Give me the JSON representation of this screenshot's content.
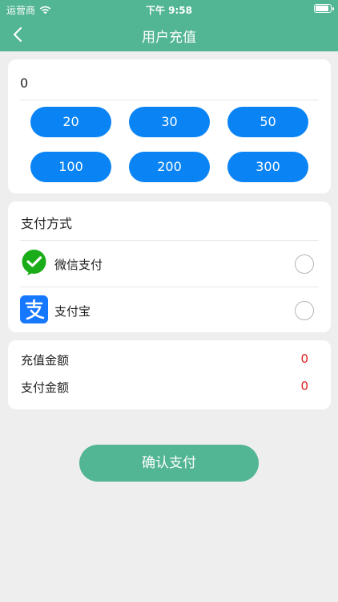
{
  "status_bar": {
    "carrier": "运营商",
    "time": "下午 9:58",
    "battery_level": 0.95
  },
  "nav": {
    "title": "用户充值",
    "back_icon": "chevron-left-icon"
  },
  "recharge": {
    "amount_value": "0",
    "options": [
      "20",
      "30",
      "50",
      "100",
      "200",
      "300"
    ]
  },
  "payment": {
    "section_title": "支付方式",
    "methods": [
      {
        "label": "微信支付",
        "icon": "wechat-pay-icon",
        "selected": false
      },
      {
        "label": "支付宝",
        "icon": "alipay-icon",
        "selected": false
      }
    ]
  },
  "summary": {
    "recharge_label": "充值金额",
    "recharge_value": "0",
    "pay_label": "支付金额",
    "pay_value": "0"
  },
  "confirm_label": "确认支付",
  "colors": {
    "header": "#52b594",
    "button_blue": "#0a84f5",
    "amount_red": "#e02020",
    "wechat_green": "#1aad19",
    "alipay_blue": "#1677ff"
  }
}
